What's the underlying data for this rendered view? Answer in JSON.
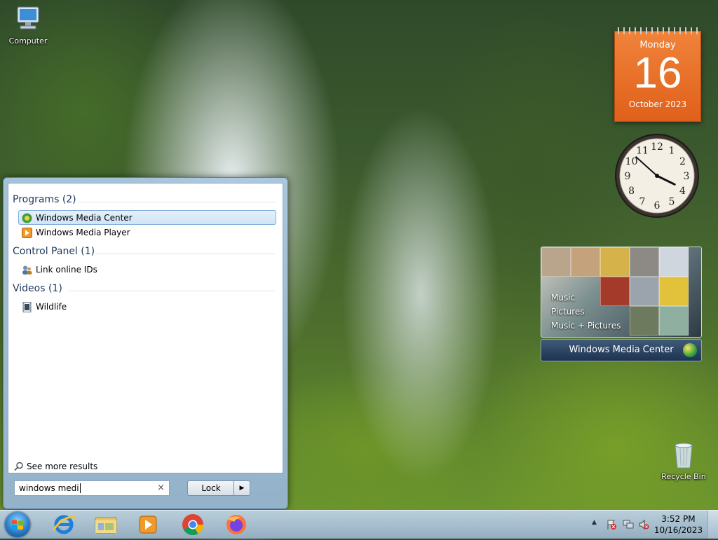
{
  "desktop": {
    "icons": [
      {
        "label": "Computer",
        "icon": "computer-icon"
      },
      {
        "label": "Recycle Bin",
        "icon": "recycle-bin-icon"
      }
    ]
  },
  "calendar_gadget": {
    "weekday": "Monday",
    "day": "16",
    "month_year": "October 2023",
    "color": "#e8702a"
  },
  "clock_gadget": {
    "numerals": [
      "12",
      "1",
      "2",
      "3",
      "4",
      "5",
      "6",
      "7",
      "8",
      "9",
      "10",
      "11"
    ],
    "time": "3:52"
  },
  "media_center_gadget": {
    "menu_items": [
      "Music",
      "Pictures",
      "Music + Pictures"
    ],
    "brand": "Windows Media Center"
  },
  "start_menu": {
    "groups": [
      {
        "heading": "Programs (2)",
        "items": [
          {
            "label": "Windows Media Center",
            "icon": "media-center-icon",
            "selected": true
          },
          {
            "label": "Windows Media Player",
            "icon": "media-player-icon",
            "selected": false
          }
        ]
      },
      {
        "heading": "Control Panel (1)",
        "items": [
          {
            "label": "Link online IDs",
            "icon": "users-icon",
            "selected": false
          }
        ]
      },
      {
        "heading": "Videos (1)",
        "items": [
          {
            "label": "Wildlife",
            "icon": "video-file-icon",
            "selected": false
          }
        ]
      }
    ],
    "see_more": "See more results",
    "search_value": "windows medi",
    "clear_glyph": "×",
    "lock_label": "Lock",
    "lock_arrow": "▶"
  },
  "taskbar": {
    "pinned": [
      "internet-explorer-icon",
      "file-explorer-icon",
      "media-player-icon",
      "chrome-icon",
      "firefox-icon"
    ],
    "tray_arrow": "▲",
    "time": "3:52 PM",
    "date": "10/16/2023"
  }
}
